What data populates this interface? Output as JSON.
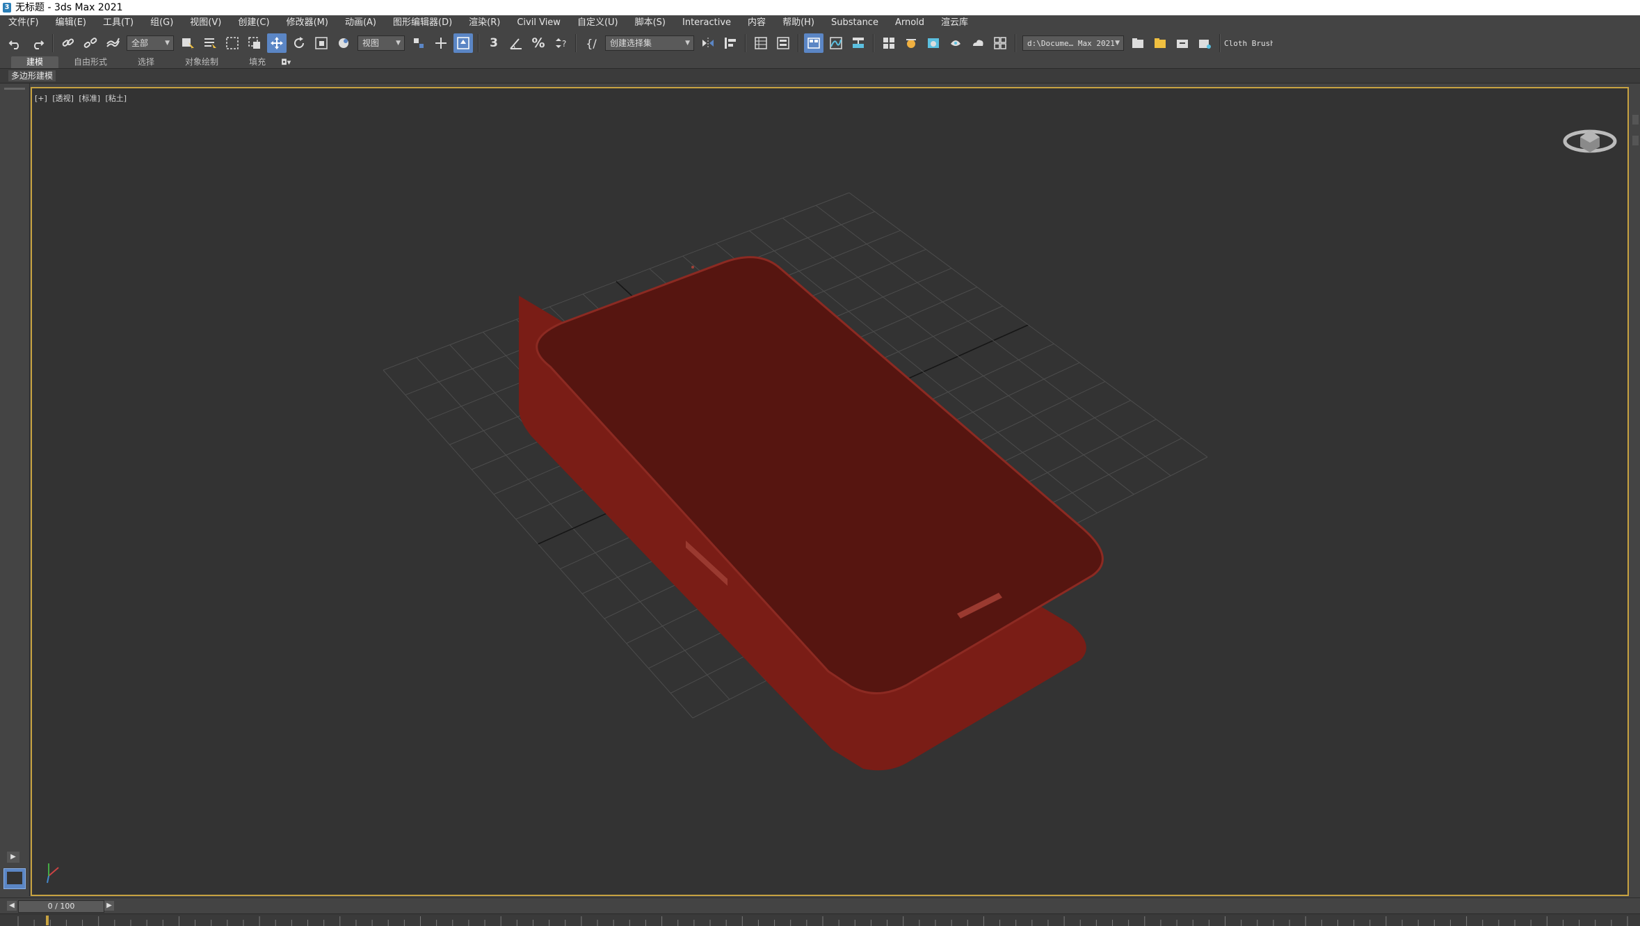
{
  "window": {
    "title": "无标题 - 3ds Max 2021",
    "app_icon": "3ds-max-icon"
  },
  "menu": [
    "文件(F)",
    "编辑(E)",
    "工具(T)",
    "组(G)",
    "视图(V)",
    "创建(C)",
    "修改器(M)",
    "动画(A)",
    "图形编辑器(D)",
    "渲染(R)",
    "Civil View",
    "自定义(U)",
    "脚本(S)",
    "Interactive",
    "内容",
    "帮助(H)",
    "Substance",
    "Arnold",
    "渲云库"
  ],
  "toolbar": {
    "selection_filter": "全部",
    "reference_coord": "视图",
    "named_selection": "创建选择集",
    "snap_value": "3",
    "project_path": "d:\\Docume… Max 2021",
    "cloth_brush": "Cloth Brush"
  },
  "ribbon": {
    "tabs": [
      "建模",
      "自由形式",
      "选择",
      "对象绘制",
      "填充"
    ],
    "active_tab": "建模",
    "panel_label": "多边形建模"
  },
  "viewport": {
    "labels": [
      "[+]",
      "[透视]",
      "[标准]",
      "[粘土]"
    ],
    "background": "#333333",
    "object_color": "#5a1510",
    "object_edge_color": "#8e2a22"
  },
  "timeslider": {
    "frame_display": "0 / 100",
    "prev_icon": "chevron-left-icon",
    "next_icon": "chevron-right-icon"
  },
  "colors": {
    "ui_bg": "#444444",
    "active_highlight": "#5b86c5",
    "viewport_border": "#c8a341"
  }
}
